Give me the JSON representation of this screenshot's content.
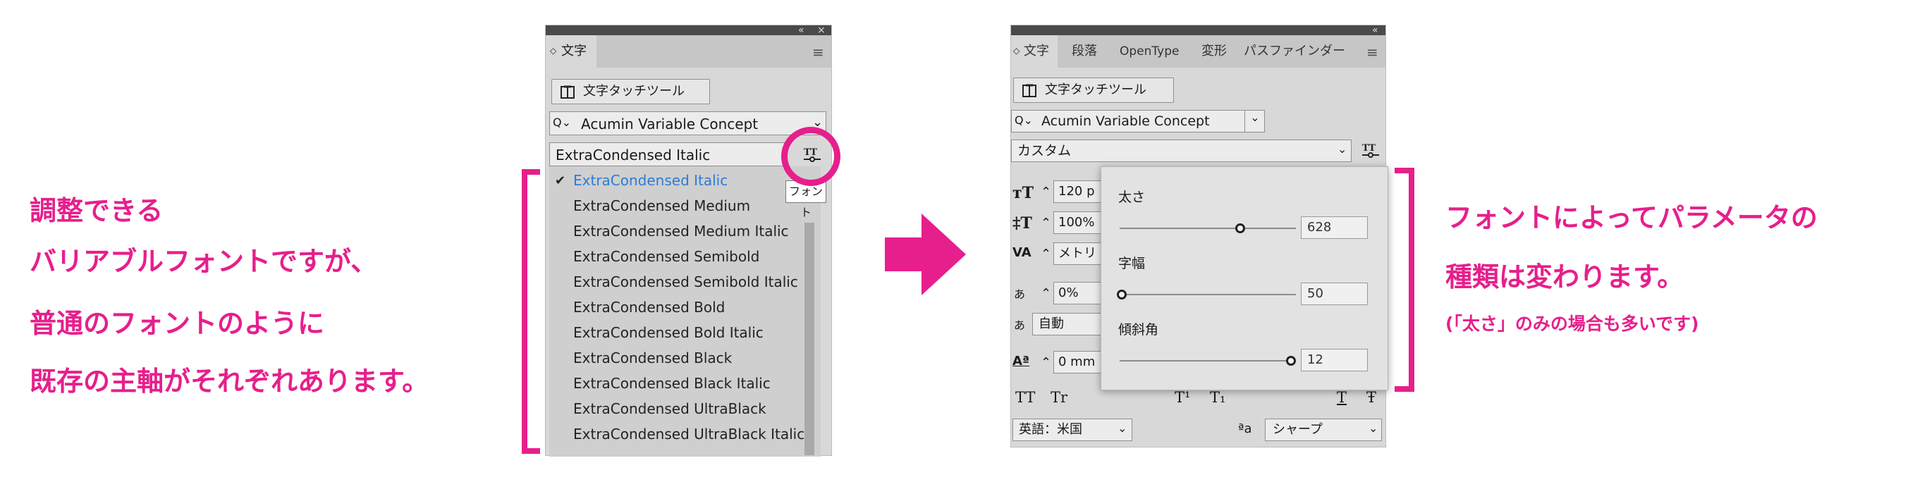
{
  "colors": {
    "accent": "#e61f8c",
    "selected_item": "#2d7bd8",
    "panel_bg": "#d8d8d8"
  },
  "left_annotation": {
    "lines": [
      "調整できる",
      "バリアブルフォントですが、",
      "普通のフォントのように",
      "既存の主軸がそれぞれあります。"
    ]
  },
  "right_annotation": {
    "lines": [
      "フォントによってパラメータの",
      "種類は変わります。"
    ],
    "note": "(「太さ」のみの場合も多いです)"
  },
  "panel1": {
    "collapse_icon": "«",
    "close_icon": "×",
    "tab_label": "文字",
    "menu_icon": "≡",
    "touch_tool_label": "文字タッチツール",
    "font_family": "Acumin Variable Concept",
    "font_style": "ExtraCondensed Italic",
    "tooltip": "フォント",
    "style_items": [
      "ExtraCondensed Italic",
      "ExtraCondensed Medium",
      "ExtraCondensed Medium Italic",
      "ExtraCondensed Semibold",
      "ExtraCondensed Semibold Italic",
      "ExtraCondensed Bold",
      "ExtraCondensed Bold Italic",
      "ExtraCondensed Black",
      "ExtraCondensed Black Italic",
      "ExtraCondensed UltraBlack",
      "ExtraCondensed UltraBlack Italic"
    ],
    "selected_index": 0
  },
  "arrow_icon": "right-arrow-icon",
  "panel2": {
    "collapse_icon": "«",
    "tabs": [
      "文字",
      "段落",
      "OpenType",
      "変形",
      "パスファインダー"
    ],
    "menu_icon": "≡",
    "touch_tool_label": "文字タッチツール",
    "font_family": "Acumin Variable Concept",
    "font_style": "カスタム",
    "size_value": "120 p",
    "leading_value": "100%",
    "kerning_value": "メトリ",
    "tsume_value": "0%",
    "aki_value": "自動",
    "baseline_value": "0 mm",
    "char_styles": [
      "TT",
      "Tr",
      "T¹",
      "T₁",
      "T",
      "Ŧ"
    ],
    "language": "英語：米国",
    "aa_label": "ªa",
    "antialias": "シャープ",
    "axes": [
      {
        "label": "太さ",
        "value": "628",
        "fraction": 0.69
      },
      {
        "label": "字幅",
        "value": "50",
        "fraction": 0.0
      },
      {
        "label": "傾斜角",
        "value": "12",
        "fraction": 1.0
      }
    ]
  }
}
